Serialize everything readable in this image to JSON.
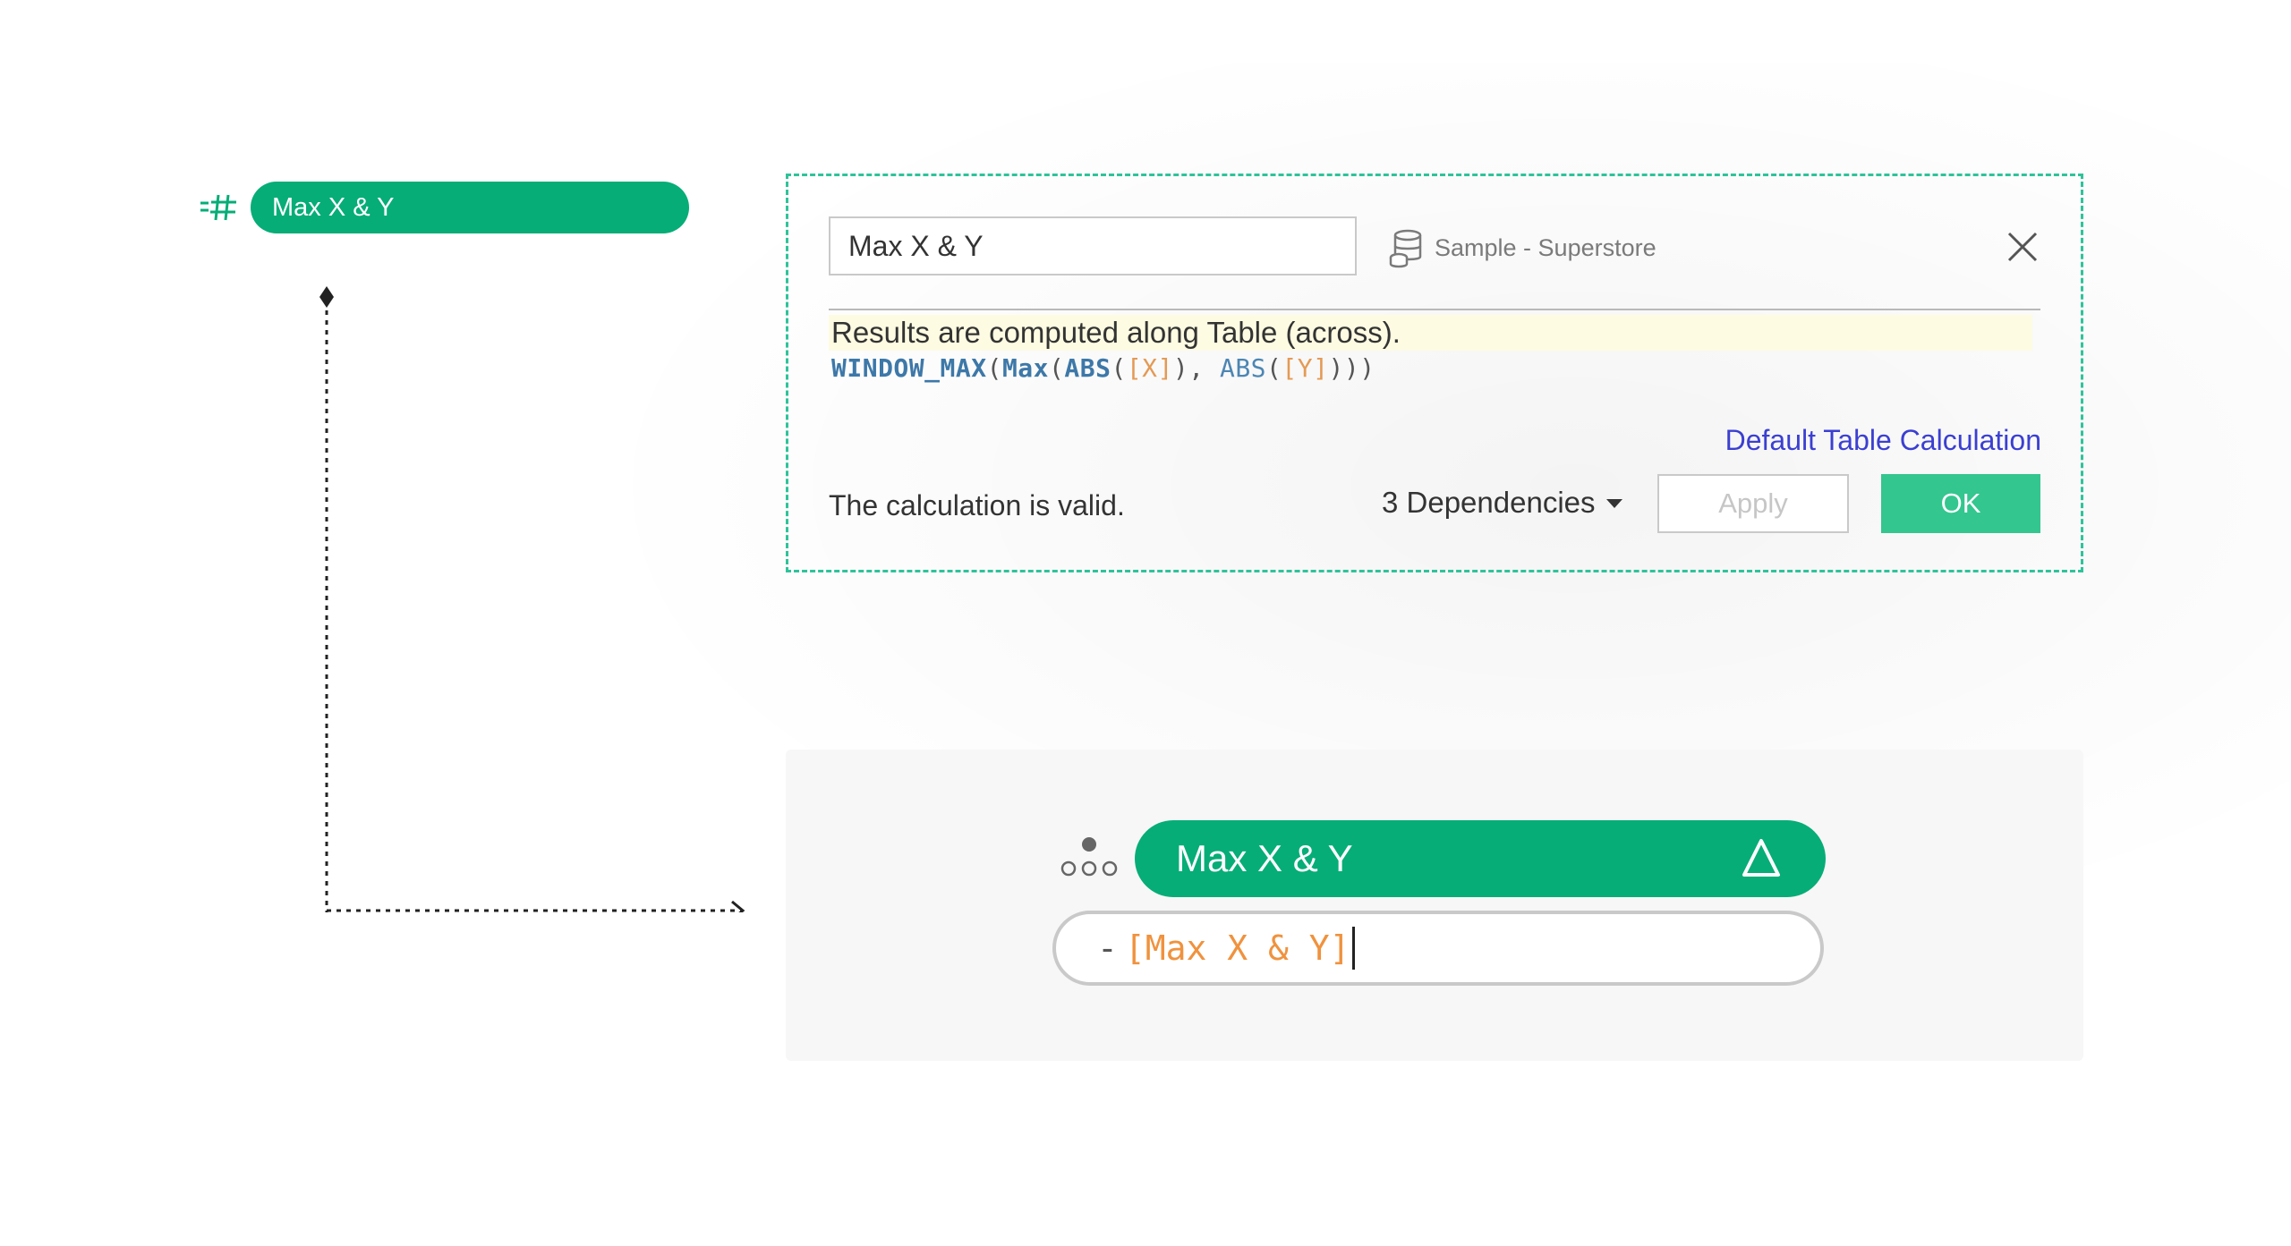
{
  "left_pill": {
    "label": "Max X & Y",
    "icon": "measure-hash-icon"
  },
  "dialog": {
    "name_value": "Max X & Y",
    "datasource": {
      "label": "Sample - Superstore",
      "icon": "database-icon"
    },
    "results_note": "Results are computed along Table (across).",
    "formula": {
      "func1": "WINDOW_MAX",
      "open1": "(",
      "func2": "Max",
      "open2": "(",
      "func3": "ABS",
      "open3": "(",
      "field1": "[X]",
      "close3": "), ",
      "func4": "ABS",
      "open4": "(",
      "field2": "[Y]",
      "close_all": ")))"
    },
    "default_table_calc_link": "Default Table Calculation",
    "status": "The calculation is valid.",
    "dependencies": "3 Dependencies",
    "apply_label": "Apply",
    "ok_label": "OK"
  },
  "bottom": {
    "pill_label": "Max X & Y",
    "pill_icon": "delta-icon",
    "edit_minus": "-",
    "edit_value": "[Max X & Y]"
  },
  "colors": {
    "accent_green": "#06ad77",
    "ok_green": "#33c68f",
    "link_blue": "#3b3fd1",
    "field_orange": "#f0923e"
  }
}
